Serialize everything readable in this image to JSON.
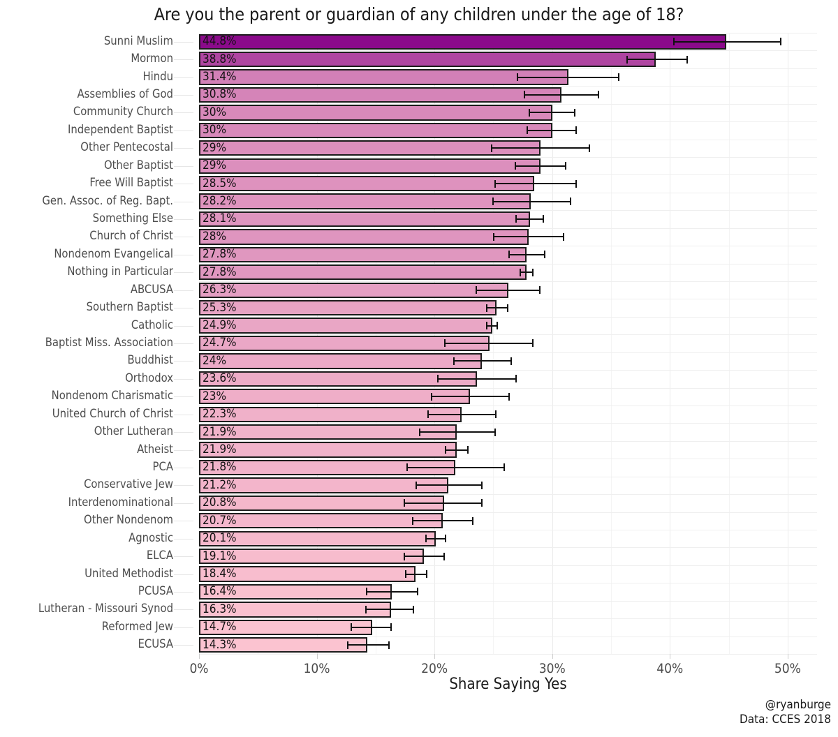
{
  "title": "Are you the parent or guardian of any children under the age of 18?",
  "axis": {
    "xlabel": "Share Saying Yes",
    "xticks": [
      "0%",
      "10%",
      "20%",
      "30%",
      "40%",
      "50%"
    ],
    "xtick_values": [
      0,
      10,
      20,
      30,
      40,
      50
    ]
  },
  "caption": {
    "handle": "@ryanburge",
    "source": "Data: CCES 2018"
  },
  "colors": {
    "bar_high": "#8B0A8B",
    "bar_low": "#FBC3D0",
    "bar_outline": "#1c1c1c",
    "grid": "#ebebeb",
    "text": "#4d4d4d",
    "background": "#ffffff"
  },
  "chart_data": {
    "type": "bar",
    "orientation": "horizontal",
    "title": "Are you the parent or guardian of any children under the age of 18?",
    "xlabel": "Share Saying Yes",
    "ylabel": "",
    "xlim": [
      0,
      52.5
    ],
    "grid": true,
    "legend": null,
    "error_bars": "95% confidence interval",
    "categories": [
      "Sunni Muslim",
      "Mormon",
      "Hindu",
      "Assemblies of God",
      "Community Church",
      "Independent Baptist",
      "Other Pentecostal",
      "Other Baptist",
      "Free Will Baptist",
      "Gen. Assoc. of Reg. Bapt.",
      "Something Else",
      "Church of Christ",
      "Nondenom Evangelical",
      "Nothing in Particular",
      "ABCUSA",
      "Southern Baptist",
      "Catholic",
      "Baptist Miss. Association",
      "Buddhist",
      "Orthodox",
      "Nondenom Charismatic",
      "United Church of Christ",
      "Other Lutheran",
      "Atheist",
      "PCA",
      "Conservative Jew",
      "Interdenominational",
      "Other Nondenom",
      "Agnostic",
      "ELCA",
      "United Methodist",
      "PCUSA",
      "Lutheran - Missouri Synod",
      "Reformed Jew",
      "ECUSA"
    ],
    "values": [
      44.8,
      38.8,
      31.4,
      30.8,
      30.0,
      30.0,
      29.0,
      29.0,
      28.5,
      28.2,
      28.1,
      28.0,
      27.8,
      27.8,
      26.3,
      25.3,
      24.9,
      24.7,
      24.0,
      23.6,
      23.0,
      22.3,
      21.9,
      21.9,
      21.8,
      21.2,
      20.8,
      20.7,
      20.1,
      19.1,
      18.4,
      16.4,
      16.3,
      14.7,
      14.3
    ],
    "value_labels": [
      "44.8%",
      "38.8%",
      "31.4%",
      "30.8%",
      "30%",
      "30%",
      "29%",
      "29%",
      "28.5%",
      "28.2%",
      "28.1%",
      "28%",
      "27.8%",
      "27.8%",
      "26.3%",
      "25.3%",
      "24.9%",
      "24.7%",
      "24%",
      "23.6%",
      "23%",
      "22.3%",
      "21.9%",
      "21.9%",
      "21.8%",
      "21.2%",
      "20.8%",
      "20.7%",
      "20.1%",
      "19.1%",
      "18.4%",
      "16.4%",
      "16.3%",
      "14.7%",
      "14.3%"
    ],
    "ci_low": [
      40.3,
      36.3,
      27.0,
      27.6,
      28.0,
      27.8,
      24.8,
      26.8,
      25.1,
      24.9,
      26.9,
      25.0,
      26.3,
      27.2,
      23.5,
      24.4,
      24.4,
      20.8,
      21.6,
      20.2,
      19.7,
      19.4,
      18.7,
      20.9,
      17.6,
      18.4,
      17.4,
      18.1,
      19.2,
      17.4,
      17.5,
      14.2,
      14.1,
      12.9,
      12.6
    ],
    "ci_high": [
      49.5,
      41.5,
      35.7,
      34.0,
      32.0,
      32.1,
      33.2,
      31.2,
      32.1,
      31.6,
      29.3,
      31.0,
      29.4,
      28.4,
      29.0,
      26.3,
      25.4,
      28.4,
      26.6,
      27.0,
      26.4,
      25.3,
      25.2,
      22.9,
      26.0,
      24.1,
      24.1,
      23.3,
      21.0,
      20.9,
      19.4,
      18.6,
      18.3,
      16.4,
      16.2
    ]
  }
}
